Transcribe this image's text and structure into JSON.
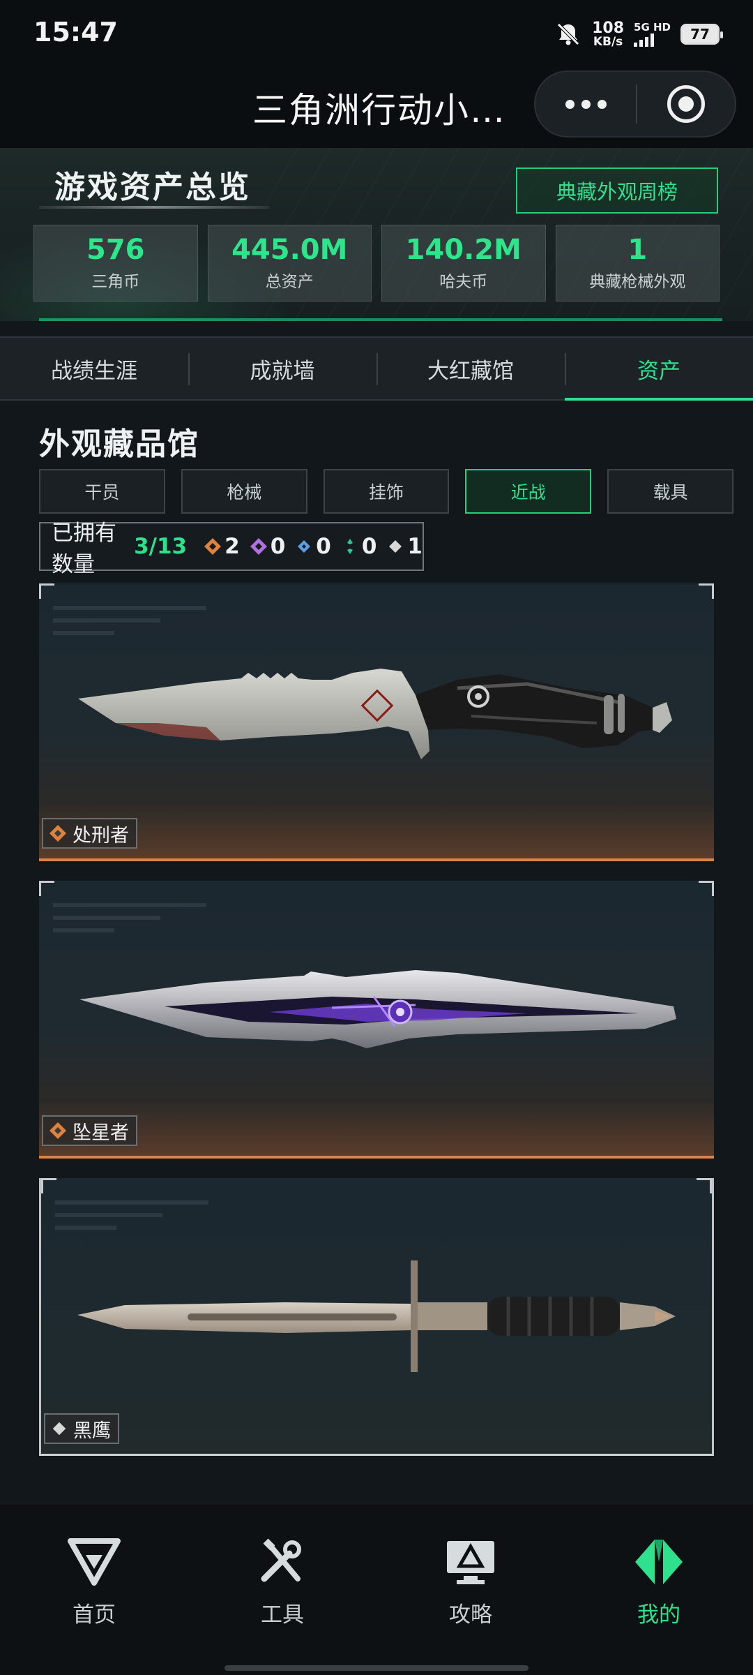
{
  "status_bar": {
    "time": "15:47",
    "net_speed_value": "108",
    "net_speed_unit": "KB/s",
    "network_type": "5G HD",
    "battery": "77"
  },
  "title_bar": {
    "title": "三角洲行动小…",
    "more_icon": "more-dots-icon",
    "close_icon": "target-circle-icon"
  },
  "overview": {
    "title": "游戏资产总览",
    "ranking_button": "典藏外观周榜",
    "stats": [
      {
        "value": "576",
        "label": "三角币"
      },
      {
        "value": "445.0M",
        "label": "总资产"
      },
      {
        "value": "140.2M",
        "label": "哈夫币"
      },
      {
        "value": "1",
        "label": "典藏枪械外观"
      }
    ]
  },
  "tabs": [
    {
      "label": "战绩生涯",
      "active": false
    },
    {
      "label": "成就墙",
      "active": false
    },
    {
      "label": "大红藏馆",
      "active": false
    },
    {
      "label": "资产",
      "active": true
    }
  ],
  "collection": {
    "title": "外观藏品馆",
    "filters": [
      {
        "label": "干员",
        "active": false
      },
      {
        "label": "枪械",
        "active": false
      },
      {
        "label": "挂饰",
        "active": false
      },
      {
        "label": "近战",
        "active": true
      },
      {
        "label": "载具",
        "active": false
      }
    ],
    "owned_label": "已拥有数量",
    "owned_count": "3/13",
    "rarity_counts": [
      {
        "icon": "orange-diamond-icon",
        "color": "#e0823f",
        "count": "2"
      },
      {
        "icon": "purple-diamond-icon",
        "color": "#b070e0",
        "count": "0"
      },
      {
        "icon": "blue-diamond-icon",
        "color": "#5aa0e0",
        "count": "0"
      },
      {
        "icon": "green-diamond-icon",
        "color": "#30c890",
        "count": "0"
      },
      {
        "icon": "white-diamond-icon",
        "color": "#d8d8d8",
        "count": "1"
      }
    ],
    "items": [
      {
        "name": "处刑者",
        "rarity_color": "#e0823f"
      },
      {
        "name": "坠星者",
        "rarity_color": "#e0823f"
      },
      {
        "name": "黑鹰",
        "rarity_color": "#d8d8d8"
      }
    ]
  },
  "bottom_nav": [
    {
      "label": "首页",
      "icon": "delta-logo-icon",
      "active": false
    },
    {
      "label": "工具",
      "icon": "tools-icon",
      "active": false
    },
    {
      "label": "攻略",
      "icon": "guide-monitor-icon",
      "active": false
    },
    {
      "label": "我的",
      "icon": "profile-logo-icon",
      "active": true
    }
  ],
  "colors": {
    "accent_green": "#2fe08c",
    "background": "#12171b",
    "rarity_orange": "#d8854a"
  }
}
